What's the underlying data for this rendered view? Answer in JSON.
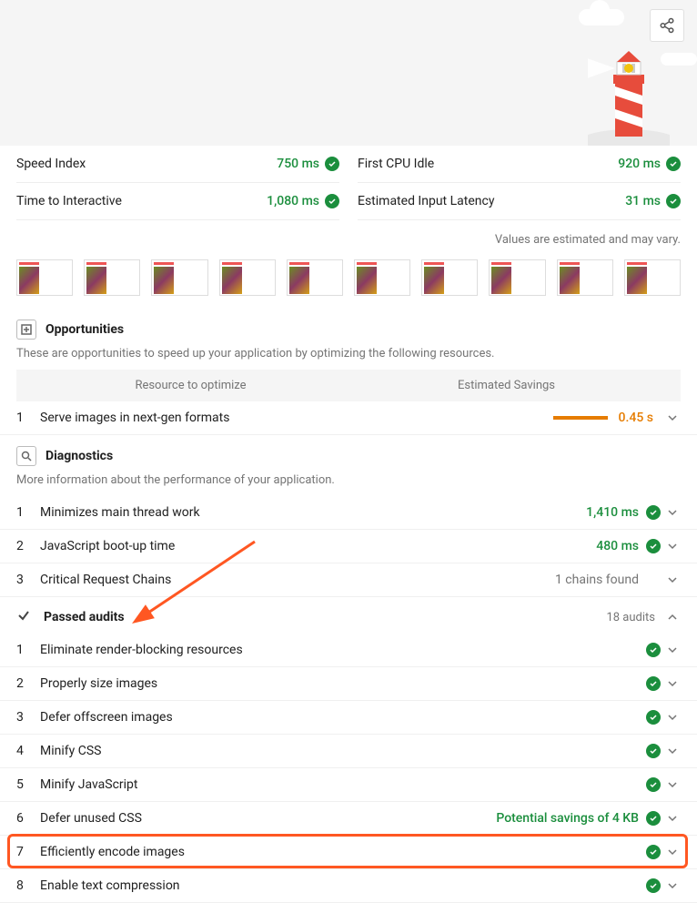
{
  "metrics": [
    {
      "label": "Speed Index",
      "value": "750 ms",
      "pass": true
    },
    {
      "label": "Time to Interactive",
      "value": "1,080 ms",
      "pass": true
    },
    {
      "label": "First CPU Idle",
      "value": "920 ms",
      "pass": true
    },
    {
      "label": "Estimated Input Latency",
      "value": "31 ms",
      "pass": true
    }
  ],
  "estimated_note": "Values are estimated and may vary.",
  "opportunities": {
    "title": "Opportunities",
    "desc": "These are opportunities to speed up your application by optimizing the following resources.",
    "col1": "Resource to optimize",
    "col2": "Estimated Savings",
    "items": [
      {
        "num": "1",
        "title": "Serve images in next-gen formats",
        "value": "0.45 s"
      }
    ]
  },
  "diagnostics": {
    "title": "Diagnostics",
    "desc": "More information about the performance of your application.",
    "items": [
      {
        "num": "1",
        "title": "Minimizes main thread work",
        "value": "1,410 ms",
        "pass": true
      },
      {
        "num": "2",
        "title": "JavaScript boot-up time",
        "value": "480 ms",
        "pass": true
      },
      {
        "num": "3",
        "title": "Critical Request Chains",
        "value": "1 chains found",
        "gray": true
      }
    ]
  },
  "passed": {
    "title": "Passed audits",
    "count": "18 audits",
    "items": [
      {
        "num": "1",
        "title": "Eliminate render-blocking resources"
      },
      {
        "num": "2",
        "title": "Properly size images"
      },
      {
        "num": "3",
        "title": "Defer offscreen images"
      },
      {
        "num": "4",
        "title": "Minify CSS"
      },
      {
        "num": "5",
        "title": "Minify JavaScript"
      },
      {
        "num": "6",
        "title": "Defer unused CSS",
        "value": "Potential savings of 4 KB"
      },
      {
        "num": "7",
        "title": "Efficiently encode images"
      },
      {
        "num": "8",
        "title": "Enable text compression"
      }
    ]
  }
}
